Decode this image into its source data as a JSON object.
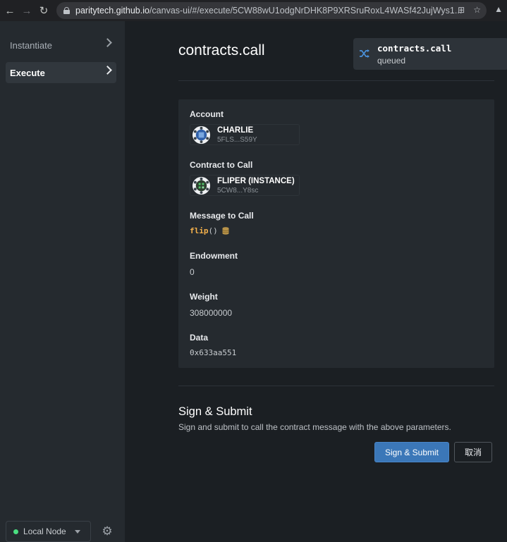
{
  "browser": {
    "url_host": "paritytech.github.io",
    "url_path": "/canvas-ui/#/execute/5CW88wU1odgNrDHK8P9XRSruRoxL4WASf42JujWys1..."
  },
  "sidebar": {
    "items": [
      {
        "label": "Instantiate",
        "active": false
      },
      {
        "label": "Execute",
        "active": true
      }
    ],
    "node_select": {
      "label": "Local Node",
      "status_color": "#4ade80"
    }
  },
  "page": {
    "title": "contracts.call"
  },
  "toast": {
    "title": "contracts.call",
    "status": "queued",
    "icon": "shuffle-icon"
  },
  "form": {
    "account": {
      "label": "Account",
      "name": "CHARLIE",
      "address": "5FLS...S59Y"
    },
    "contract": {
      "label": "Contract to Call",
      "name": "FLIPER (INSTANCE)",
      "address": "5CW8...Y8sc"
    },
    "message": {
      "label": "Message to Call",
      "fn": "flip",
      "parens": "()",
      "icon": "database-icon"
    },
    "endowment": {
      "label": "Endowment",
      "value": "0"
    },
    "weight": {
      "label": "Weight",
      "value": "308000000"
    },
    "data": {
      "label": "Data",
      "value": "0x633aa551"
    }
  },
  "sign": {
    "title": "Sign & Submit",
    "description": "Sign and submit to call the contract message with the above parameters.",
    "submit_label": "Sign & Submit",
    "cancel_label": "取消"
  },
  "colors": {
    "accent": "#3b77b8",
    "message_fn": "#f5b14b"
  }
}
